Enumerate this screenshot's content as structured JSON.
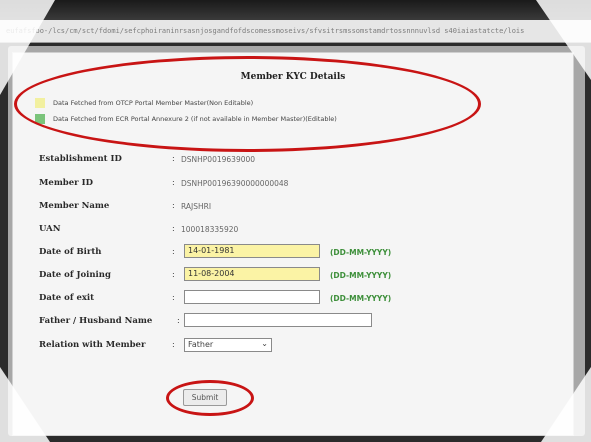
{
  "browser": {
    "url": "eufafsfoo-/lcs/cm/sct/fdomi/sefcphoiraninrsasnjosgandfofdscomessmoseivs/sfvsitrsmssomstamdrtossnnnuvlsd s40iaiastatcte/lois"
  },
  "form": {
    "title": "Member KYC Details",
    "legend": [
      {
        "text": "Data Fetched from OTCP Portal Member Master(Non Editable)",
        "color": "#f2f0a0"
      },
      {
        "text": "Data Fetched from ECR Portal Annexure 2 (if not available in Member Master)(Editable)",
        "color": "#7bc47b"
      }
    ],
    "fields": {
      "establishment_id": {
        "label": "Establishment ID",
        "value": "DSNHP0019639000"
      },
      "member_id": {
        "label": "Member ID",
        "value": "DSNHP00196390000000048"
      },
      "member_name": {
        "label": "Member Name",
        "value": "RAJSHRI"
      },
      "uan": {
        "label": "UAN",
        "value": "100018335920"
      },
      "dob": {
        "label": "Date of Birth",
        "value": "14-01-1981",
        "format": "(DD-MM-YYYY)"
      },
      "doj": {
        "label": "Date of Joining",
        "value": "11-08-2004",
        "format": "(DD-MM-YYYY)"
      },
      "doe": {
        "label": "Date of exit",
        "value": "",
        "format": "(DD-MM-YYYY)"
      },
      "father_husband": {
        "label": "Father / Husband Name",
        "value": ""
      },
      "relation": {
        "label": "Relation with Member",
        "selected": "Father"
      }
    },
    "colon": ":",
    "submit_label": "Submit"
  },
  "annotation_color": "#c81414"
}
